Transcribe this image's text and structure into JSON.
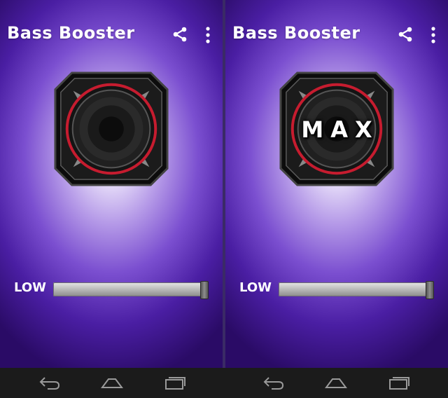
{
  "screens": [
    {
      "app_title": "Bass Booster",
      "speaker_overlay": "",
      "slider": {
        "label": "LOW",
        "value": 1.0
      }
    },
    {
      "app_title": "Bass Booster",
      "speaker_overlay": "MAX",
      "slider": {
        "label": "LOW",
        "value": 1.0
      }
    }
  ],
  "navbar": {
    "buttons": [
      "back-icon",
      "home-icon",
      "recent-apps-icon"
    ]
  },
  "colors": {
    "background_center": "#ffffff",
    "background_edge": "#2a0b66",
    "accent_ring": "#c61c2f",
    "navbar": "#1b1b1b"
  }
}
